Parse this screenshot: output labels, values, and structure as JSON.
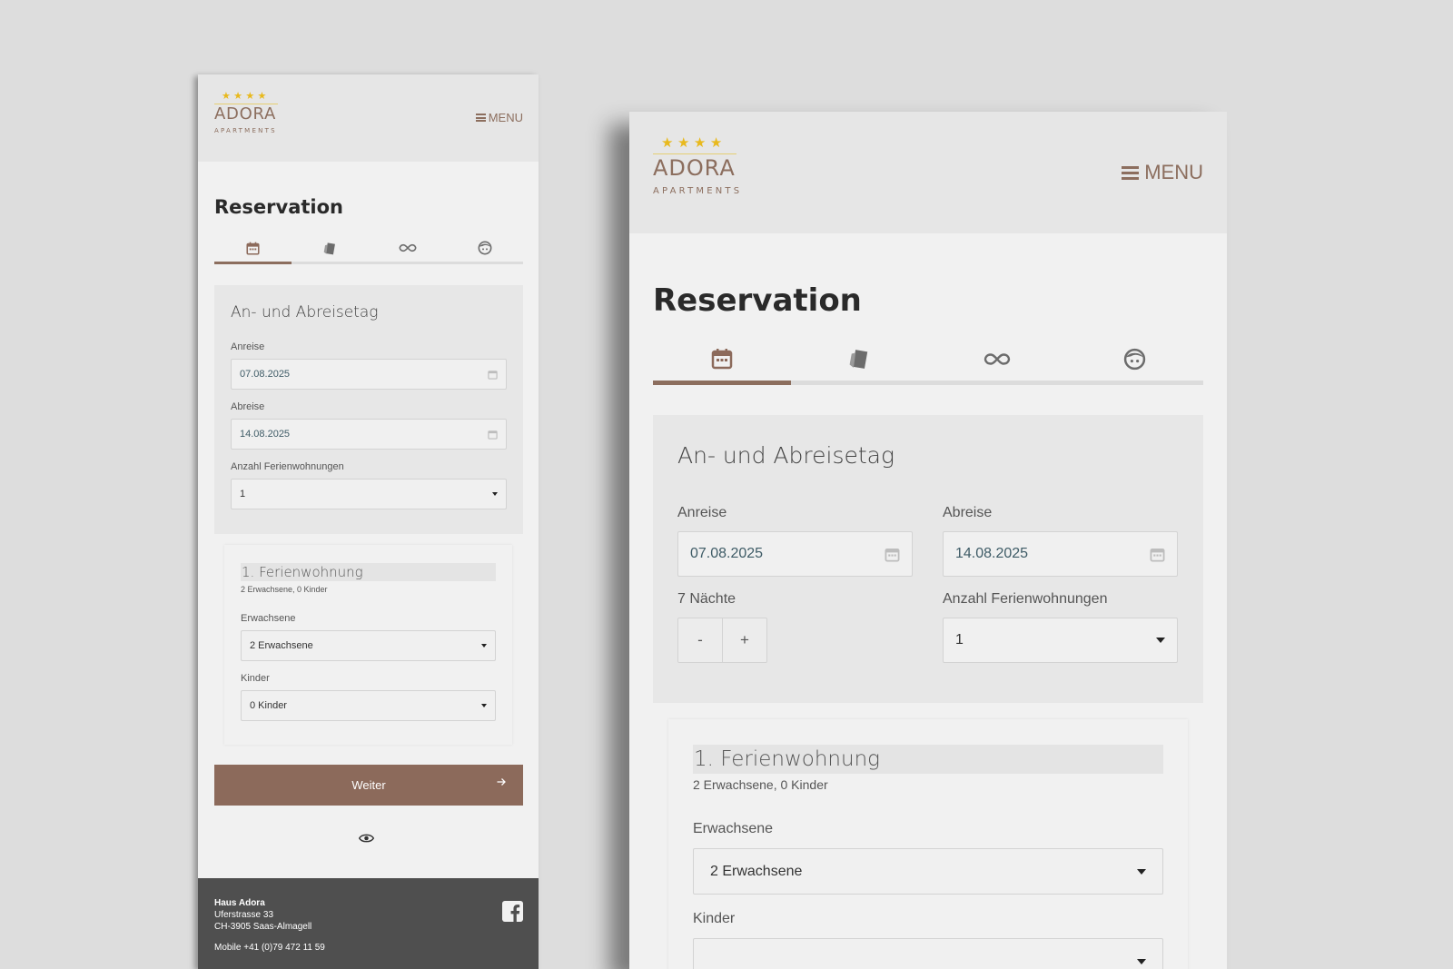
{
  "brand": {
    "stars": "★★★★",
    "name": "ADORA",
    "subtitle": "APARTMENTS"
  },
  "header": {
    "menu_label": "MENU"
  },
  "page": {
    "title": "Reservation"
  },
  "tabs": [
    {
      "name": "dates",
      "icon": "calendar-icon",
      "active": true
    },
    {
      "name": "apartment",
      "icon": "bookmark-tag-icon",
      "active": false
    },
    {
      "name": "extras",
      "icon": "infinity-icon",
      "active": false
    },
    {
      "name": "guest",
      "icon": "face-icon",
      "active": false
    }
  ],
  "dates_panel": {
    "title": "An- und Abreisetag",
    "arrival_label": "Anreise",
    "arrival_value": "07.08.2025",
    "departure_label": "Abreise",
    "departure_value": "14.08.2025",
    "nights_label": "7 Nächte",
    "minus_label": "-",
    "plus_label": "+",
    "apartments_label": "Anzahl Ferienwohnungen",
    "apartments_value": "1"
  },
  "apartment_card": {
    "title": "1. Ferienwohnung",
    "summary": "2 Erwachsene, 0 Kinder",
    "adults_label": "Erwachsene",
    "adults_value": "2 Erwachsene",
    "children_label": "Kinder",
    "children_value": "0 Kinder"
  },
  "next_button": {
    "label": "Weiter"
  },
  "footer": {
    "name": "Haus Adora",
    "street": "Uferstrasse 33",
    "city": "CH-3905 Saas-Almagell",
    "phone": "Mobile +41 (0)79 472 11 59"
  },
  "colors": {
    "accent": "#8c6a5b",
    "stars": "#e8b91d",
    "footer": "#4f4f4f",
    "background": "#dddddd"
  }
}
